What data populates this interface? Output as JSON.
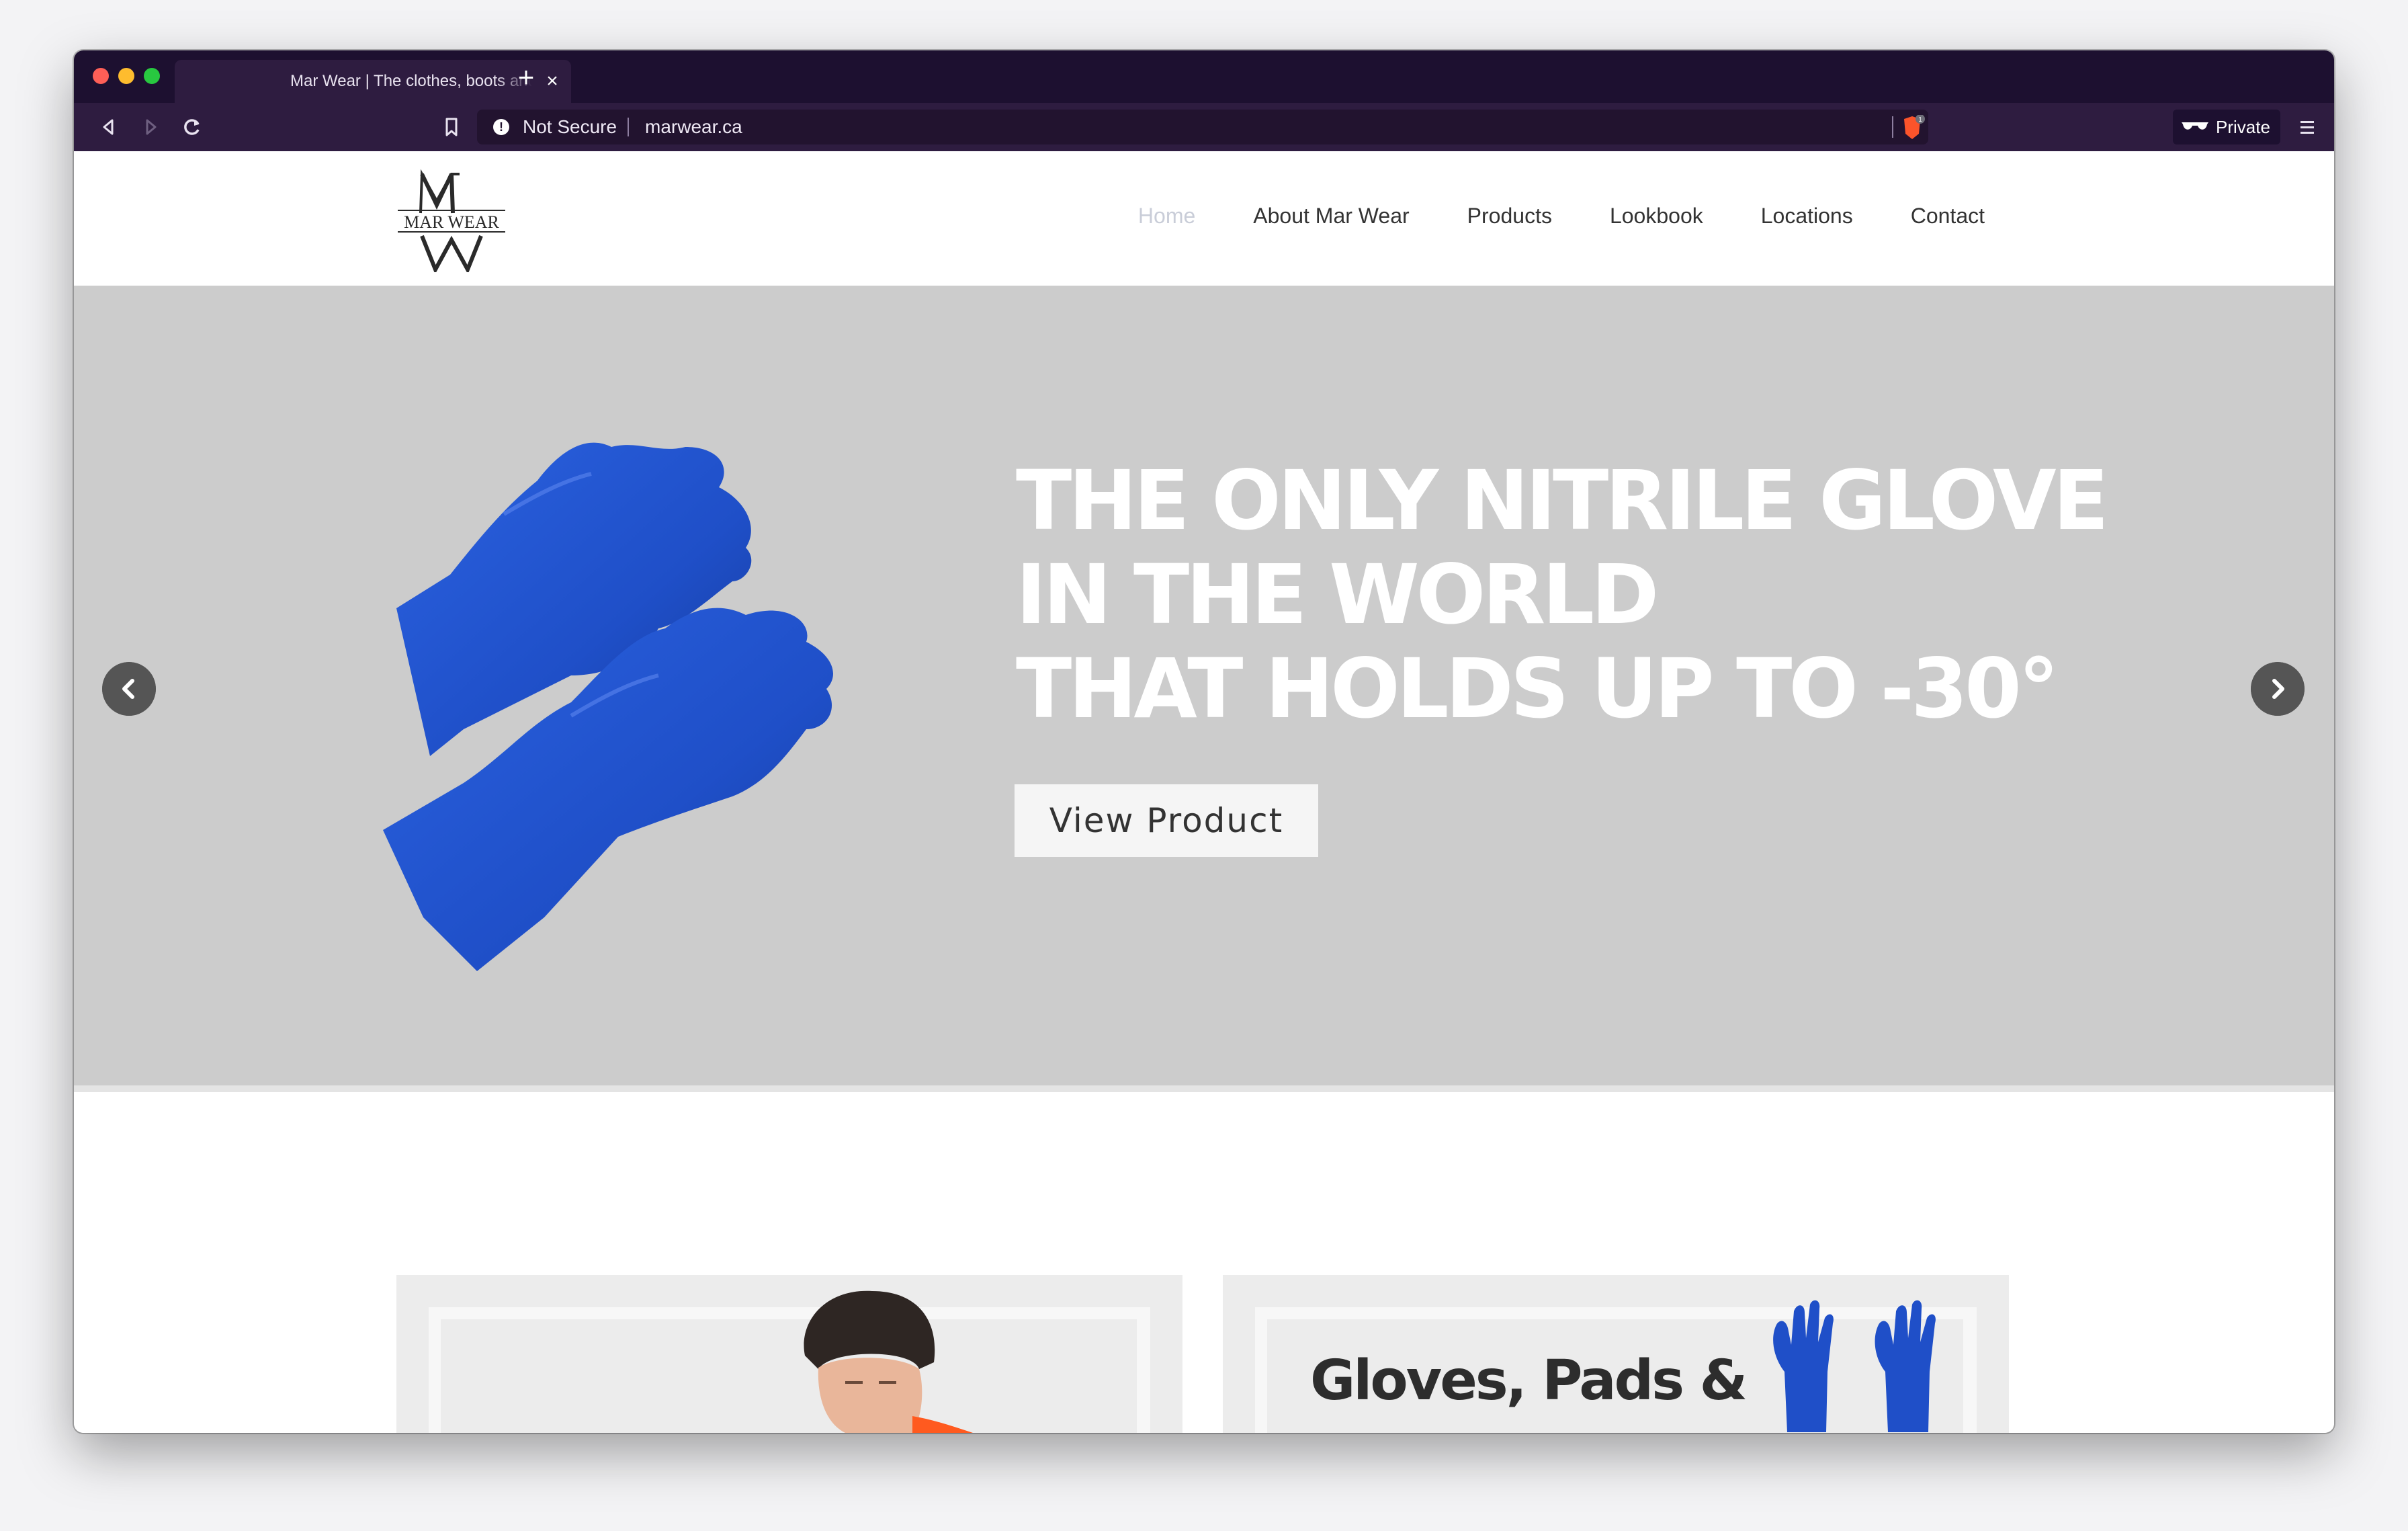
{
  "browser": {
    "tab_title": "Mar Wear | The clothes, boots and",
    "tab_close": "×",
    "new_tab": "+",
    "security_label": "Not Secure",
    "url": "marwear.ca",
    "private_label": "Private",
    "shield_count": "1"
  },
  "site": {
    "logo_text": "MAR WEAR",
    "nav": [
      "Home",
      "About Mar Wear",
      "Products",
      "Lookbook",
      "Locations",
      "Contact"
    ],
    "active_nav": "Home"
  },
  "hero": {
    "headline": [
      "THE ONLY NITRILE GLOVE",
      "IN THE WORLD",
      "THAT HOLDS UP TO -30°"
    ],
    "button_label": "View Product",
    "bg_color": "#cccccc",
    "product_color": "#1f4fc8"
  },
  "cards": [
    {
      "title": "",
      "image": "worker-in-beanie"
    },
    {
      "title": "Gloves, Pads &",
      "image": "blue-gloves"
    }
  ]
}
